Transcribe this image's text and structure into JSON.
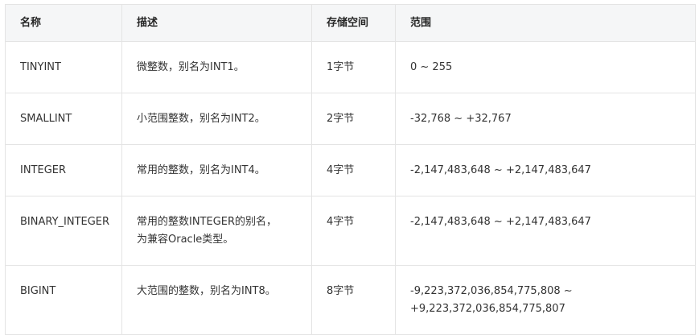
{
  "table": {
    "headers": [
      "名称",
      "描述",
      "存储空间",
      "范围"
    ],
    "rows": [
      {
        "name": "TINYINT",
        "desc": [
          "微整数，别名为INT1。"
        ],
        "size": "1字节",
        "range": [
          "0 ~ 255"
        ]
      },
      {
        "name": "SMALLINT",
        "desc": [
          "小范围整数，别名为INT2。"
        ],
        "size": "2字节",
        "range": [
          "-32,768 ~ +32,767"
        ]
      },
      {
        "name": "INTEGER",
        "desc": [
          "常用的整数，别名为INT4。"
        ],
        "size": "4字节",
        "range": [
          "-2,147,483,648 ~ +2,147,483,647"
        ]
      },
      {
        "name": "BINARY_INTEGER",
        "desc": [
          "常用的整数INTEGER的别名，",
          "为兼容Oracle类型。"
        ],
        "size": "4字节",
        "range": [
          "-2,147,483,648 ~ +2,147,483,647"
        ]
      },
      {
        "name": "BIGINT",
        "desc": [
          "大范围的整数，别名为INT8。"
        ],
        "size": "8字节",
        "range": [
          "-9,223,372,036,854,775,808 ~",
          "+9,223,372,036,854,775,807"
        ]
      }
    ]
  }
}
